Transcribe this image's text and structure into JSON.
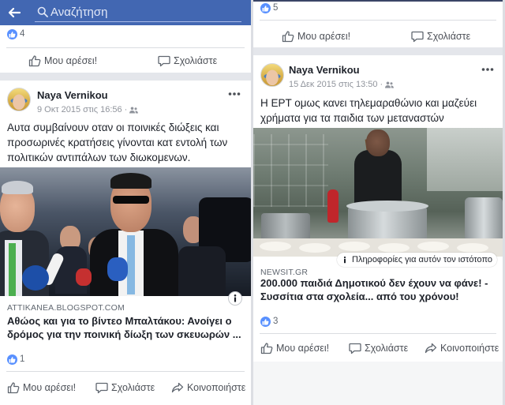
{
  "header": {
    "search": {
      "placeholder": "Αναζήτηση"
    }
  },
  "left_column": {
    "previous_post": {
      "reaction_count": "4",
      "actions": {
        "like": "Μου αρέσει!",
        "comment": "Σχολιάστε"
      }
    },
    "post": {
      "author": "Naya Vernikou",
      "timestamp": "9 Οκτ 2015 στις 16:56",
      "meta_separator": "·",
      "audience_icon": "friends-icon",
      "text": "Αυτα συμβαίνουν οταν οι ποινικές διώξεις και προσωρινές κρατήσεις γίνονται κατ εντολή των πολιτικών αντιπάλων των διωκομενων.",
      "link_preview": {
        "domain": "ATTIKANEA.BLOGSPOT.COM",
        "title": "Αθώος και για το βίντεο Μπαλτάκου: Ανοίγει ο δρόμος για την ποινική δίωξη των σκευωρών ..."
      },
      "reaction_count": "1",
      "actions": {
        "like": "Μου αρέσει!",
        "comment": "Σχολιάστε",
        "share": "Κοινοποιήστε"
      }
    }
  },
  "right_column": {
    "previous_post": {
      "reaction_count": "5",
      "actions": {
        "like": "Μου αρέσει!",
        "comment": "Σχολιάστε"
      }
    },
    "post": {
      "author": "Naya Vernikou",
      "timestamp": "15 Δεκ 2015 στις 13:50",
      "meta_separator": "·",
      "audience_icon": "friends-icon",
      "text": "Η ΕΡΤ ομως κανει τηλεμαραθώνιο και μαζεύει χρήματα για τα παιδια των μεταναστών",
      "link_preview": {
        "site_info_label": "Πληροφορίες για αυτόν τον ιστότοπο",
        "domain": "NEWSIT.GR",
        "title": "200.000 παιδιά Δημοτικού δεν έχουν να φάνε! - Συσσίτια στα σχολεία... από του χρόνου!"
      },
      "reaction_count": "3",
      "actions": {
        "like": "Μου αρέσει!",
        "comment": "Σχολιάστε",
        "share": "Κοινοποιήστε"
      }
    }
  },
  "colors": {
    "header_blue": "#4267b2",
    "like_blue": "#5890ff",
    "text_primary": "#1d2129",
    "text_secondary": "#90949c",
    "feed_separator": "#e4e6eb"
  }
}
